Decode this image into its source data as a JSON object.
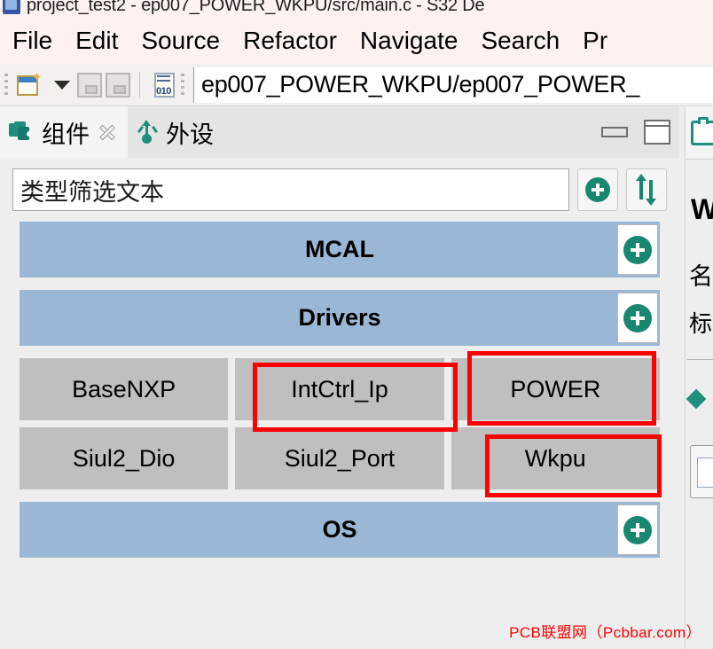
{
  "window": {
    "title": "project_test2 - ep007_POWER_WKPU/src/main.c - S32 De",
    "app_icon": "s32-design-studio-icon"
  },
  "menubar": {
    "items": [
      {
        "label": "File"
      },
      {
        "label": "Edit"
      },
      {
        "label": "Source"
      },
      {
        "label": "Refactor"
      },
      {
        "label": "Navigate"
      },
      {
        "label": "Search"
      },
      {
        "label": "Pr"
      }
    ]
  },
  "toolbar": {
    "new_icon": "new-file-icon",
    "dropdown_icon": "chevron-down-icon",
    "save_icon": "save-icon",
    "save_all_icon": "save-all-icon",
    "binary_icon": "binary-file-icon",
    "binary_digits": "010",
    "path_field_value": "ep007_POWER_WKPU/ep007_POWER_"
  },
  "view": {
    "tabs": [
      {
        "label": "组件",
        "icon": "components-icon",
        "active": true,
        "closable": true
      },
      {
        "label": "外设",
        "icon": "usb-peripherals-icon",
        "active": false,
        "closable": false
      }
    ],
    "controls": {
      "minimize": "minimize-view-icon",
      "maximize": "maximize-view-icon"
    },
    "filter": {
      "value": "类型筛选文本",
      "placeholder": "类型筛选文本",
      "add_button_icon": "plus-circle-icon",
      "sort_button_icon": "sort-arrows-icon"
    },
    "tree": [
      {
        "type": "category",
        "title": "MCAL",
        "add_icon": "plus-circle-icon",
        "components": []
      },
      {
        "type": "category",
        "title": "Drivers",
        "add_icon": "plus-circle-icon",
        "components": [
          "BaseNXP",
          "IntCtrl_Ip",
          "POWER",
          "Siul2_Dio",
          "Siul2_Port",
          "Wkpu"
        ]
      },
      {
        "type": "category",
        "title": "OS",
        "add_icon": "plus-circle-icon",
        "components": []
      }
    ]
  },
  "annotations": {
    "color": "#ff0000",
    "boxes": [
      {
        "target": "IntCtrl_Ip"
      },
      {
        "target": "POWER"
      },
      {
        "target": "Wkpu"
      }
    ]
  },
  "right_panel": {
    "tab_icon": "clipboard-icon",
    "heading": "W",
    "line1": "名",
    "line2": "标",
    "marker_icon": "diamond-icon"
  },
  "watermark": {
    "text": "PCB联盟网（Pcbbar.com）",
    "color": "#ff0000"
  },
  "colors": {
    "category_header": "#9ab8d6",
    "component_button": "#bfbfbf",
    "accent_green": "#17876f",
    "annotation_red": "#ff0000",
    "panel_background": "#eeeeee"
  }
}
